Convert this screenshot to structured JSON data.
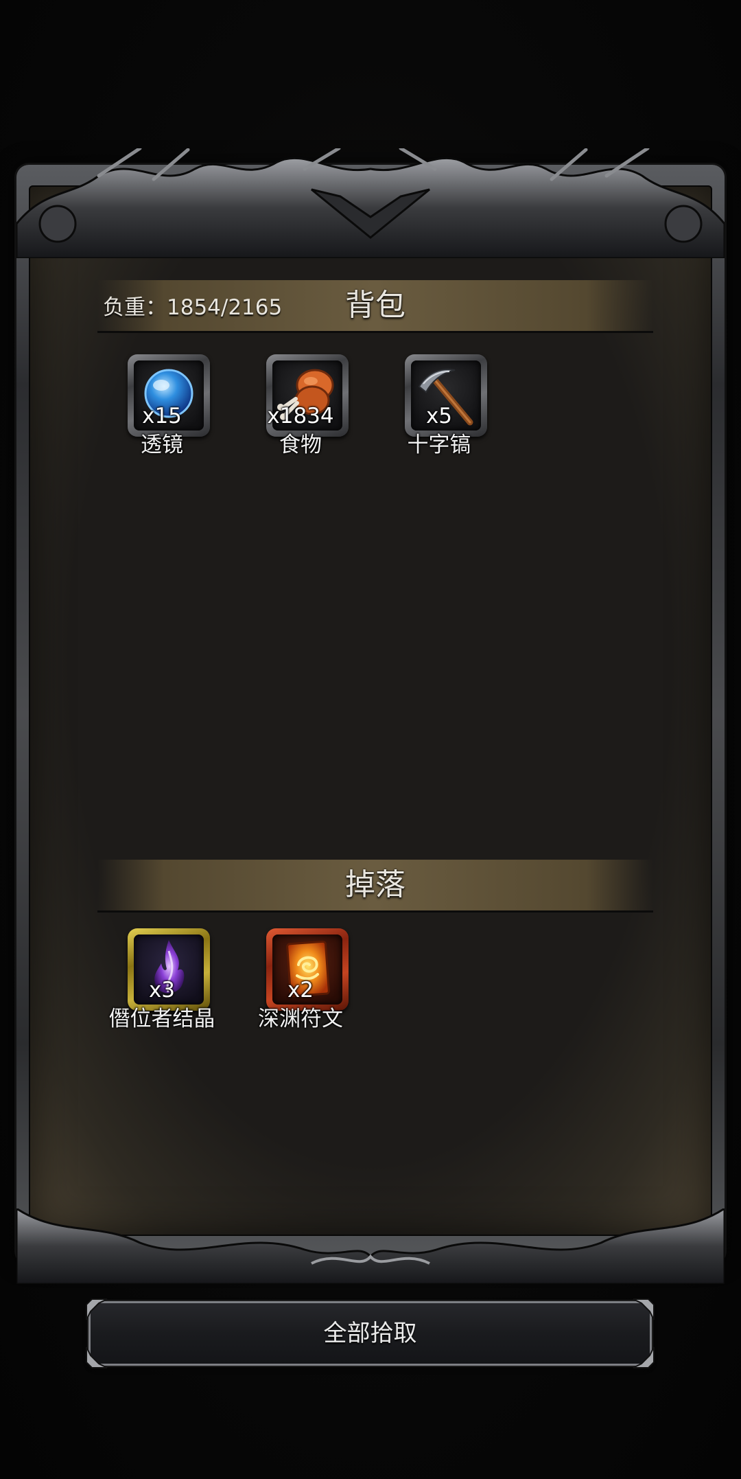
{
  "backpack": {
    "title": "背包",
    "weight_label": "负重：",
    "weight_current": 1854,
    "weight_max": 2165,
    "weight_text": "1854/2165",
    "items": [
      {
        "name": "透镜",
        "qty": "x15",
        "icon": "blue-lens-orb-icon"
      },
      {
        "name": "食物",
        "qty": "x1834",
        "icon": "roast-meat-drumstick-icon"
      },
      {
        "name": "十字镐",
        "qty": "x5",
        "icon": "pickaxe-icon"
      }
    ]
  },
  "drops": {
    "title": "掉落",
    "items": [
      {
        "name": "僭位者结晶",
        "qty": "x3",
        "icon": "purple-crystal-flame-icon",
        "rarity_color": "#c9b23a"
      },
      {
        "name": "深渊符文",
        "qty": "x2",
        "icon": "abyss-rune-card-icon",
        "rarity_color": "#c9441f"
      }
    ]
  },
  "actions": {
    "pickup_all_label": "全部拾取"
  }
}
